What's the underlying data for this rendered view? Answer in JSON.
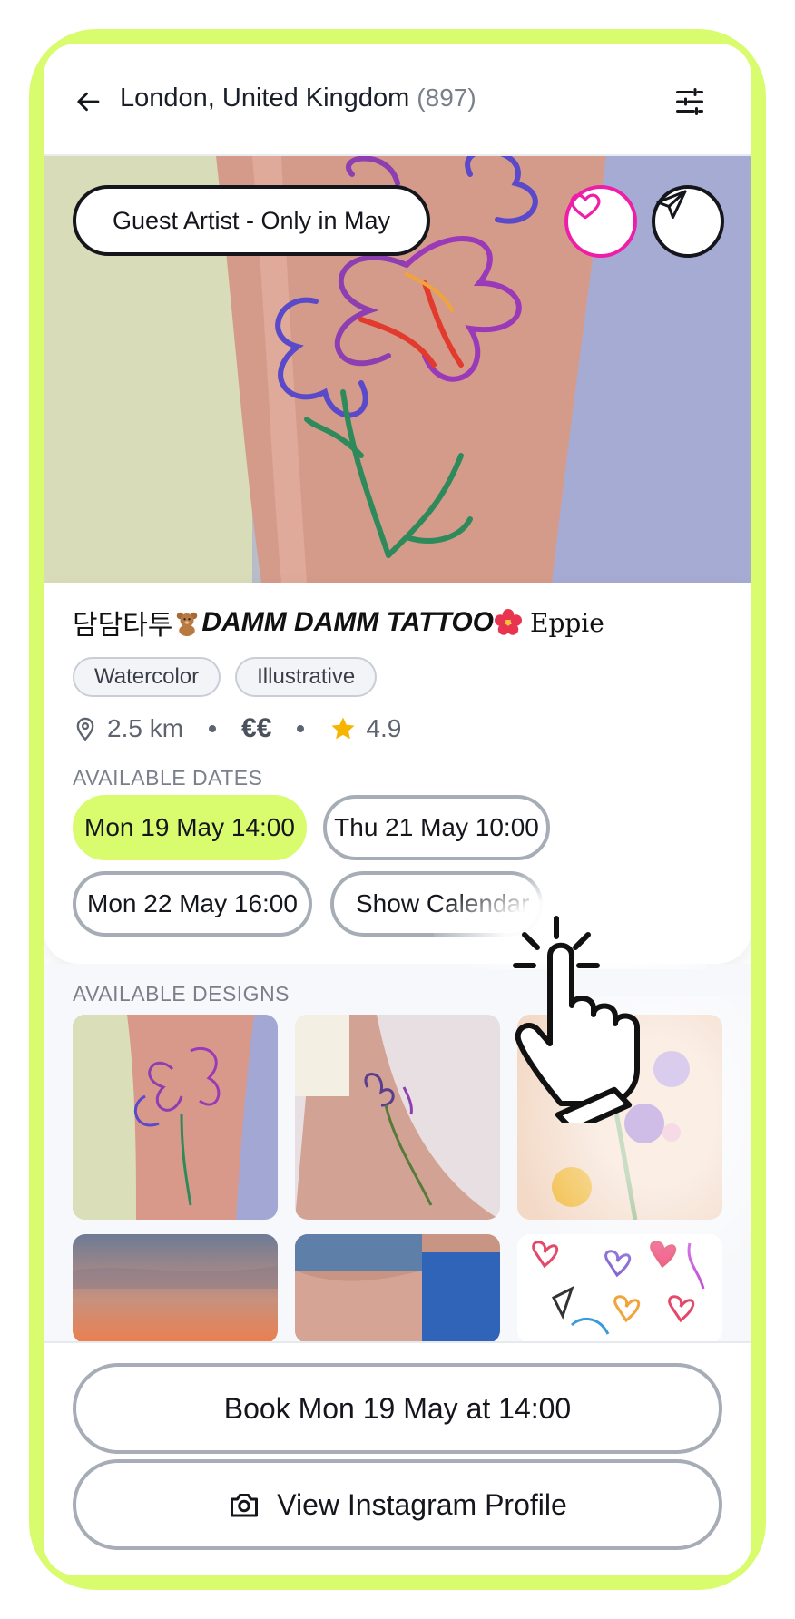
{
  "header": {
    "location": "London, United Kingdom",
    "count": "(897)",
    "back_icon": "arrow-left-icon",
    "filter_icon": "sliders-icon"
  },
  "hero": {
    "badge": "Guest Artist - Only in May",
    "favorite_icon": "heart-icon",
    "share_icon": "send-icon"
  },
  "artist": {
    "name_korean": "담담타투",
    "name_bold": "DAMM DAMM TATTOO",
    "name_suffix": "Eppie",
    "tags": [
      "Watercolor",
      "Illustrative"
    ],
    "distance": "2.5 km",
    "price": "€€",
    "rating": "4.9"
  },
  "dates": {
    "label": "AVAILABLE DATES",
    "items": [
      {
        "label": "Mon 19 May 14:00",
        "selected": true
      },
      {
        "label": "Thu 21 May 10:00",
        "selected": false
      },
      {
        "label": "Mon 22 May 16:00",
        "selected": false
      },
      {
        "label": "Show Calendar",
        "selected": false
      }
    ]
  },
  "designs": {
    "label": "AVAILABLE DESIGNS"
  },
  "actions": {
    "book": "Book Mon 19 May at 14:00",
    "instagram": "View Instagram Profile"
  },
  "colors": {
    "accent": "#d9fb6e",
    "heart": "#ee1ea8",
    "star": "#f6b500"
  }
}
